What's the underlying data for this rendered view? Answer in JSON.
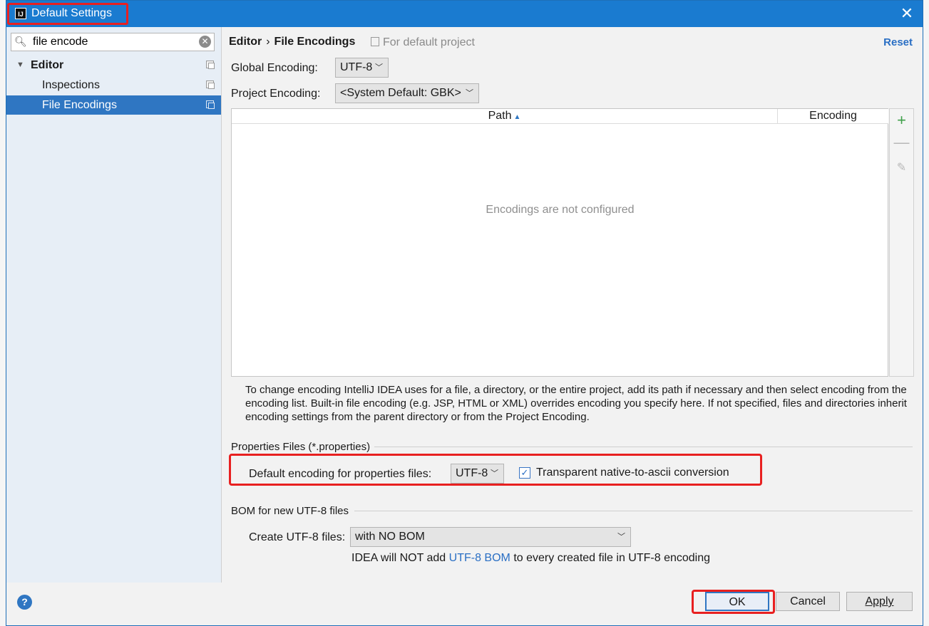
{
  "titlebar": {
    "title": "Default Settings",
    "app_icon": "IJ"
  },
  "sidebar": {
    "search": {
      "value": "file encode",
      "placeholder": ""
    },
    "tree": [
      {
        "label": "Editor"
      },
      {
        "label": "Inspections"
      },
      {
        "label": "File Encodings"
      }
    ]
  },
  "header": {
    "crumb_parent": "Editor",
    "crumb_separator": "›",
    "crumb_current": "File Encodings",
    "scope_note": "For default project",
    "reset_label": "Reset"
  },
  "encodings": {
    "global_label": "Global Encoding:",
    "global_value": "UTF-8",
    "project_label": "Project Encoding:",
    "project_value": "<System Default: GBK>"
  },
  "table": {
    "columns": [
      "Path",
      "Encoding"
    ],
    "empty_message": "Encodings are not configured"
  },
  "help": {
    "text": "To change encoding IntelliJ IDEA uses for a file, a directory, or the entire project, add its path if necessary and then select encoding from the encoding list. Built-in file encoding (e.g. JSP, HTML or XML) overrides encoding you specify here. If not specified, files and directories inherit encoding settings from the parent directory or from the Project Encoding."
  },
  "properties": {
    "group_title": "Properties Files (*.properties)",
    "default_label": "Default encoding for properties files:",
    "default_value": "UTF-8",
    "native_label": "Transparent native-to-ascii conversion",
    "native_checked": true
  },
  "bom": {
    "group_title": "BOM for new UTF-8 files",
    "create_label": "Create UTF-8 files:",
    "create_value": "with NO BOM",
    "note_prefix": "IDEA will NOT add",
    "note_link": "UTF-8 BOM",
    "note_suffix": "to every created file in UTF-8 encoding"
  },
  "footer": {
    "help_label": "?",
    "ok_label": "OK",
    "cancel_label": "Cancel",
    "apply_label": "Apply"
  },
  "colors": {
    "titlebar": "#1a7bd0",
    "selection": "#2f76c2",
    "highlight": "#e82020",
    "link": "#2a6fc4"
  }
}
